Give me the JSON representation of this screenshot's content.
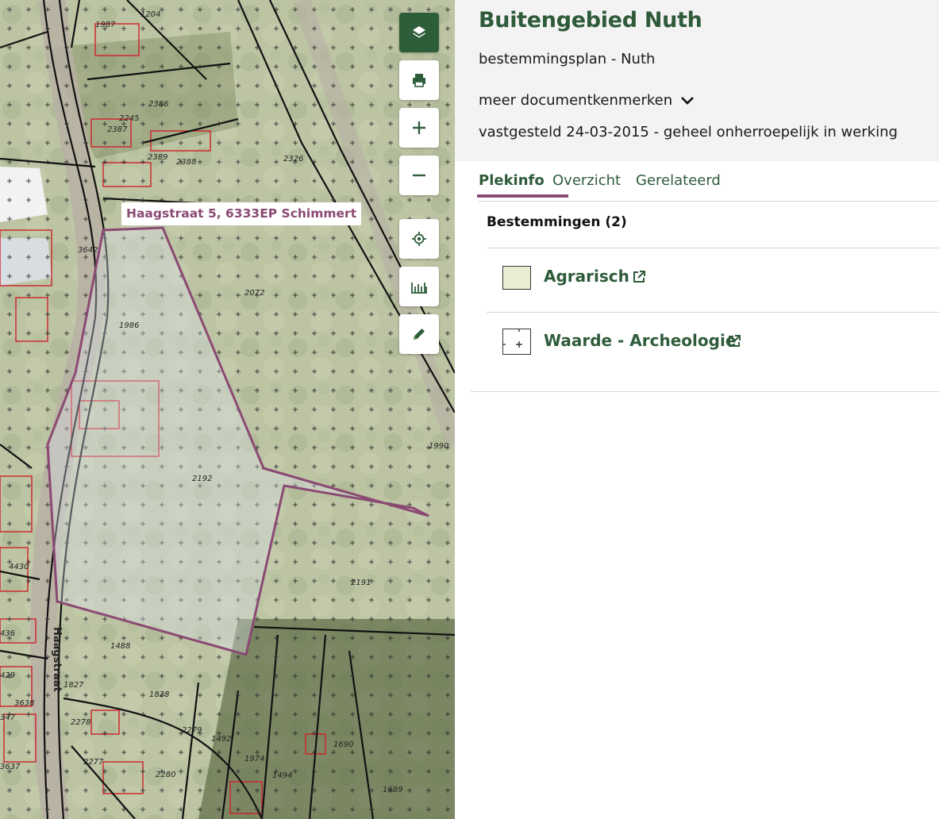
{
  "map": {
    "address_label": "Haagstraat 5, 6333EP Schimmert",
    "street_label": "Haagstraat",
    "parcel_numbers": [
      "1204",
      "1987",
      "2386",
      "2245",
      "2387",
      "2389",
      "2388",
      "2326",
      "3642",
      "2072",
      "1986",
      "1990",
      "2192",
      "2191",
      "4430",
      "436",
      "429",
      "1488",
      "1827",
      "1828",
      "3638",
      "347",
      "2278",
      "2279",
      "1492",
      "1690",
      "1974",
      "2277",
      "2280",
      "1494",
      "1689",
      "3637"
    ],
    "controls": [
      {
        "name": "layers-button",
        "icon": "layers-icon"
      },
      {
        "name": "print-button",
        "icon": "printer-icon"
      },
      {
        "name": "zoom-in-button",
        "icon": "plus-icon"
      },
      {
        "name": "zoom-out-button",
        "icon": "minus-icon"
      },
      {
        "name": "locate-button",
        "icon": "crosshair-icon"
      },
      {
        "name": "measure-button",
        "icon": "ruler-icon"
      },
      {
        "name": "draw-button",
        "icon": "pencil-icon"
      }
    ],
    "colors": {
      "highlight": "#8b4a73",
      "zone_fill": "#e9eed3",
      "parcel_line": "#111111",
      "building_line": "#d0202a"
    }
  },
  "panel": {
    "title": "Buitengebied Nuth",
    "subtitle": "bestemmingsplan - Nuth",
    "more_label": "meer documentkenmerken",
    "status": "vastgesteld 24-03-2015 - geheel onherroepelijk in werking",
    "tabs": [
      {
        "label": "Plekinfo",
        "active": true
      },
      {
        "label": "Overzicht",
        "active": false
      },
      {
        "label": "Gerelateerd",
        "active": false
      }
    ],
    "section_title": "Bestemmingen (2)",
    "items": [
      {
        "name": "Agrarisch",
        "swatch": "solid"
      },
      {
        "name": "Waarde - Archeologie",
        "swatch": "cross-pattern"
      }
    ],
    "colors": {
      "brand": "#2f5b3a",
      "accent": "#8b4a73"
    }
  }
}
